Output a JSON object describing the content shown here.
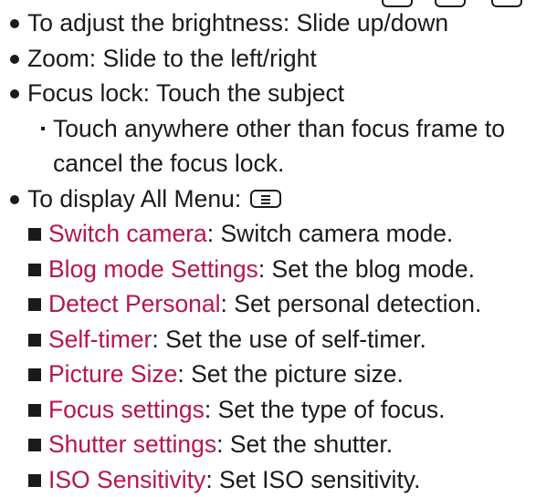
{
  "bullets": [
    "To adjust the brightness: Slide up/down",
    "Zoom: Slide to the left/right",
    "Focus lock: Touch the subject"
  ],
  "focus_note": {
    "line1": "Touch anywhere other than focus frame to",
    "line2": "cancel the focus lock."
  },
  "all_menu_label": "To display All Menu:",
  "menu_key_icon": "menu-key-icon",
  "menu_items": [
    {
      "name": "Switch camera",
      "desc": ": Switch camera mode."
    },
    {
      "name": "Blog mode Settings",
      "desc": ": Set the blog mode."
    },
    {
      "name": "Detect Personal",
      "desc": ": Set personal detection."
    },
    {
      "name": "Self-timer",
      "desc": ": Set the use of self-timer."
    },
    {
      "name": "Picture Size",
      "desc": ": Set the picture size."
    },
    {
      "name": "Focus settings",
      "desc": ": Set the type of focus."
    },
    {
      "name": "Shutter settings",
      "desc": ": Set the shutter."
    },
    {
      "name": "ISO Sensitivity",
      "desc": ": Set ISO sensitivity."
    }
  ],
  "colors": {
    "menu_name": "#b5174a",
    "text": "#1a1a1a"
  }
}
